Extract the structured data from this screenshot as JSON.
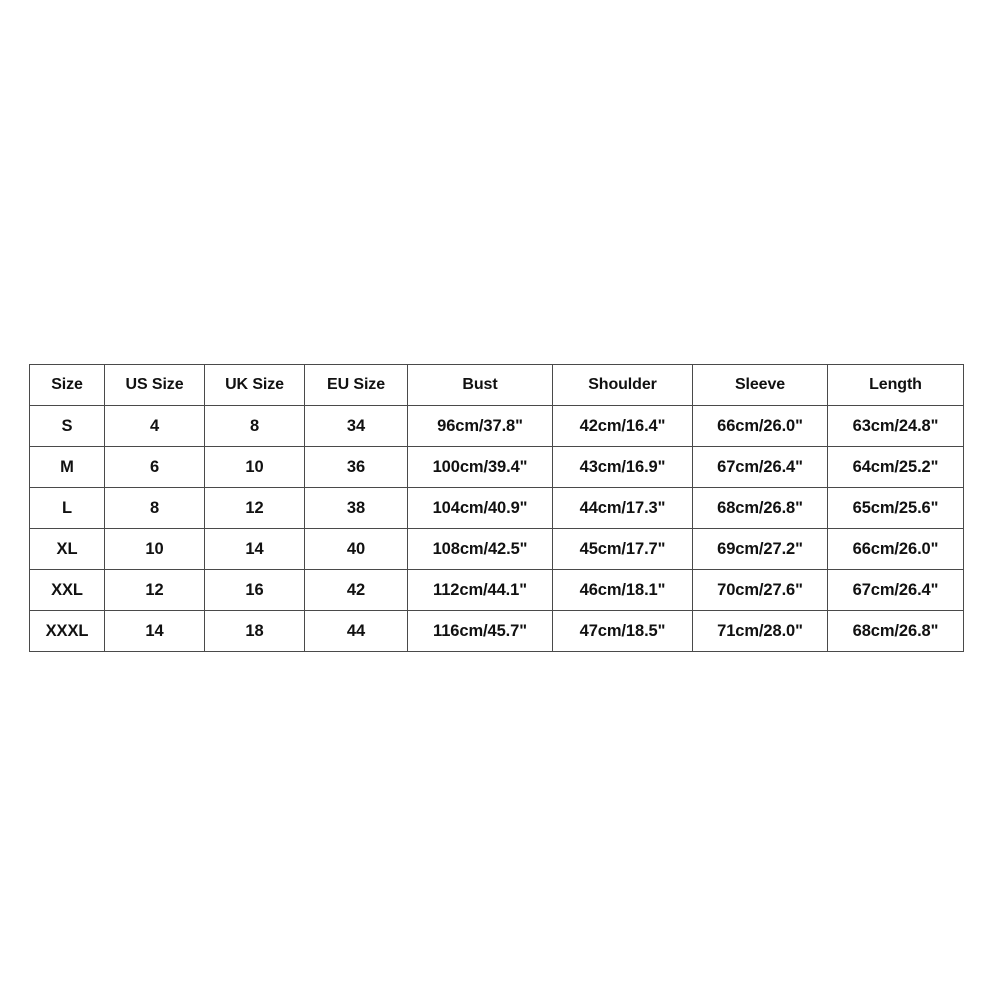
{
  "table": {
    "name": "size-chart",
    "columns": [
      "Size",
      "US Size",
      "UK Size",
      "EU Size",
      "Bust",
      "Shoulder",
      "Sleeve",
      "Length"
    ],
    "rows": [
      {
        "size": "S",
        "us_size": "4",
        "uk_size": "8",
        "eu_size": "34",
        "bust": "96cm/37.8\"",
        "shoulder": "42cm/16.4\"",
        "sleeve": "66cm/26.0\"",
        "length": "63cm/24.8\""
      },
      {
        "size": "M",
        "us_size": "6",
        "uk_size": "10",
        "eu_size": "36",
        "bust": "100cm/39.4\"",
        "shoulder": "43cm/16.9\"",
        "sleeve": "67cm/26.4\"",
        "length": "64cm/25.2\""
      },
      {
        "size": "L",
        "us_size": "8",
        "uk_size": "12",
        "eu_size": "38",
        "bust": "104cm/40.9\"",
        "shoulder": "44cm/17.3\"",
        "sleeve": "68cm/26.8\"",
        "length": "65cm/25.6\""
      },
      {
        "size": "XL",
        "us_size": "10",
        "uk_size": "14",
        "eu_size": "40",
        "bust": "108cm/42.5\"",
        "shoulder": "45cm/17.7\"",
        "sleeve": "69cm/27.2\"",
        "length": "66cm/26.0\""
      },
      {
        "size": "XXL",
        "us_size": "12",
        "uk_size": "16",
        "eu_size": "42",
        "bust": "112cm/44.1\"",
        "shoulder": "46cm/18.1\"",
        "sleeve": "70cm/27.6\"",
        "length": "67cm/26.4\""
      },
      {
        "size": "XXXL",
        "us_size": "14",
        "uk_size": "18",
        "eu_size": "44",
        "bust": "116cm/45.7\"",
        "shoulder": "47cm/18.5\"",
        "sleeve": "71cm/28.0\"",
        "length": "68cm/26.8\""
      }
    ]
  },
  "colors": {
    "page_background": "#ffffff",
    "cell_background": "#ffffff",
    "border": "#4a4a4a",
    "text": "#111111"
  }
}
